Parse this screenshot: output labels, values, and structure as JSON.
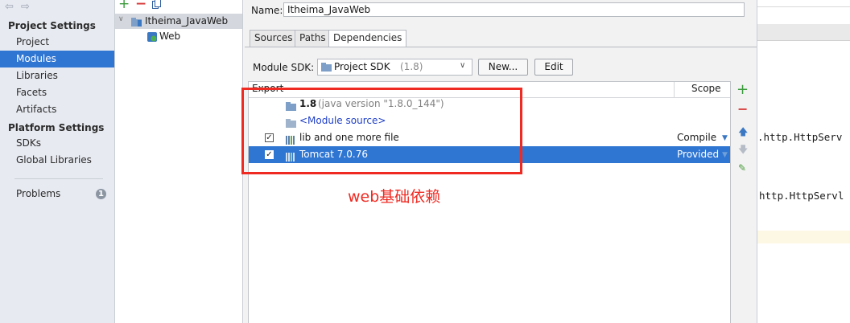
{
  "sidebar": {
    "project_settings_title": "Project Settings",
    "project_items": [
      "Project",
      "Modules",
      "Libraries",
      "Facets",
      "Artifacts"
    ],
    "platform_settings_title": "Platform Settings",
    "platform_items": [
      "SDKs",
      "Global Libraries"
    ],
    "problems_label": "Problems",
    "problems_count": "1",
    "selected_item": "Modules"
  },
  "tree": {
    "root_module": "Itheima_JavaWeb",
    "child_facet": "Web"
  },
  "detail": {
    "name_label": "Name:",
    "name_value": "Itheima_JavaWeb",
    "tabs": [
      "Sources",
      "Paths",
      "Dependencies"
    ],
    "active_tab": "Dependencies",
    "module_sdk_label": "Module SDK:",
    "sdk_value": "Project SDK",
    "sdk_version": "(1.8)",
    "new_button": "New...",
    "edit_button": "Edit",
    "table": {
      "col_export": "Export",
      "col_scope": "Scope",
      "rows": [
        {
          "name": "1.8",
          "detail": "(java version \"1.8.0_144\")",
          "scope": "",
          "checkbox": false
        },
        {
          "name": "<Module source>",
          "detail": "",
          "scope": "",
          "checkbox": false
        },
        {
          "name": "lib and one more file",
          "detail": "",
          "scope": "Compile",
          "checkbox": true
        },
        {
          "name": "Tomcat 7.0.76",
          "detail": "",
          "scope": "Provided",
          "checkbox": true
        }
      ]
    }
  },
  "editor": {
    "line1": ".http.HttpServ",
    "line2": "http.HttpServl"
  },
  "annotation": {
    "text": "web基础依赖",
    "color": "#ef2a22"
  },
  "colors": {
    "selection": "#2f76d3",
    "sidebar_bg": "#e7eaf1",
    "add_green": "#3a9a3a",
    "remove_red": "#d83b3b"
  }
}
